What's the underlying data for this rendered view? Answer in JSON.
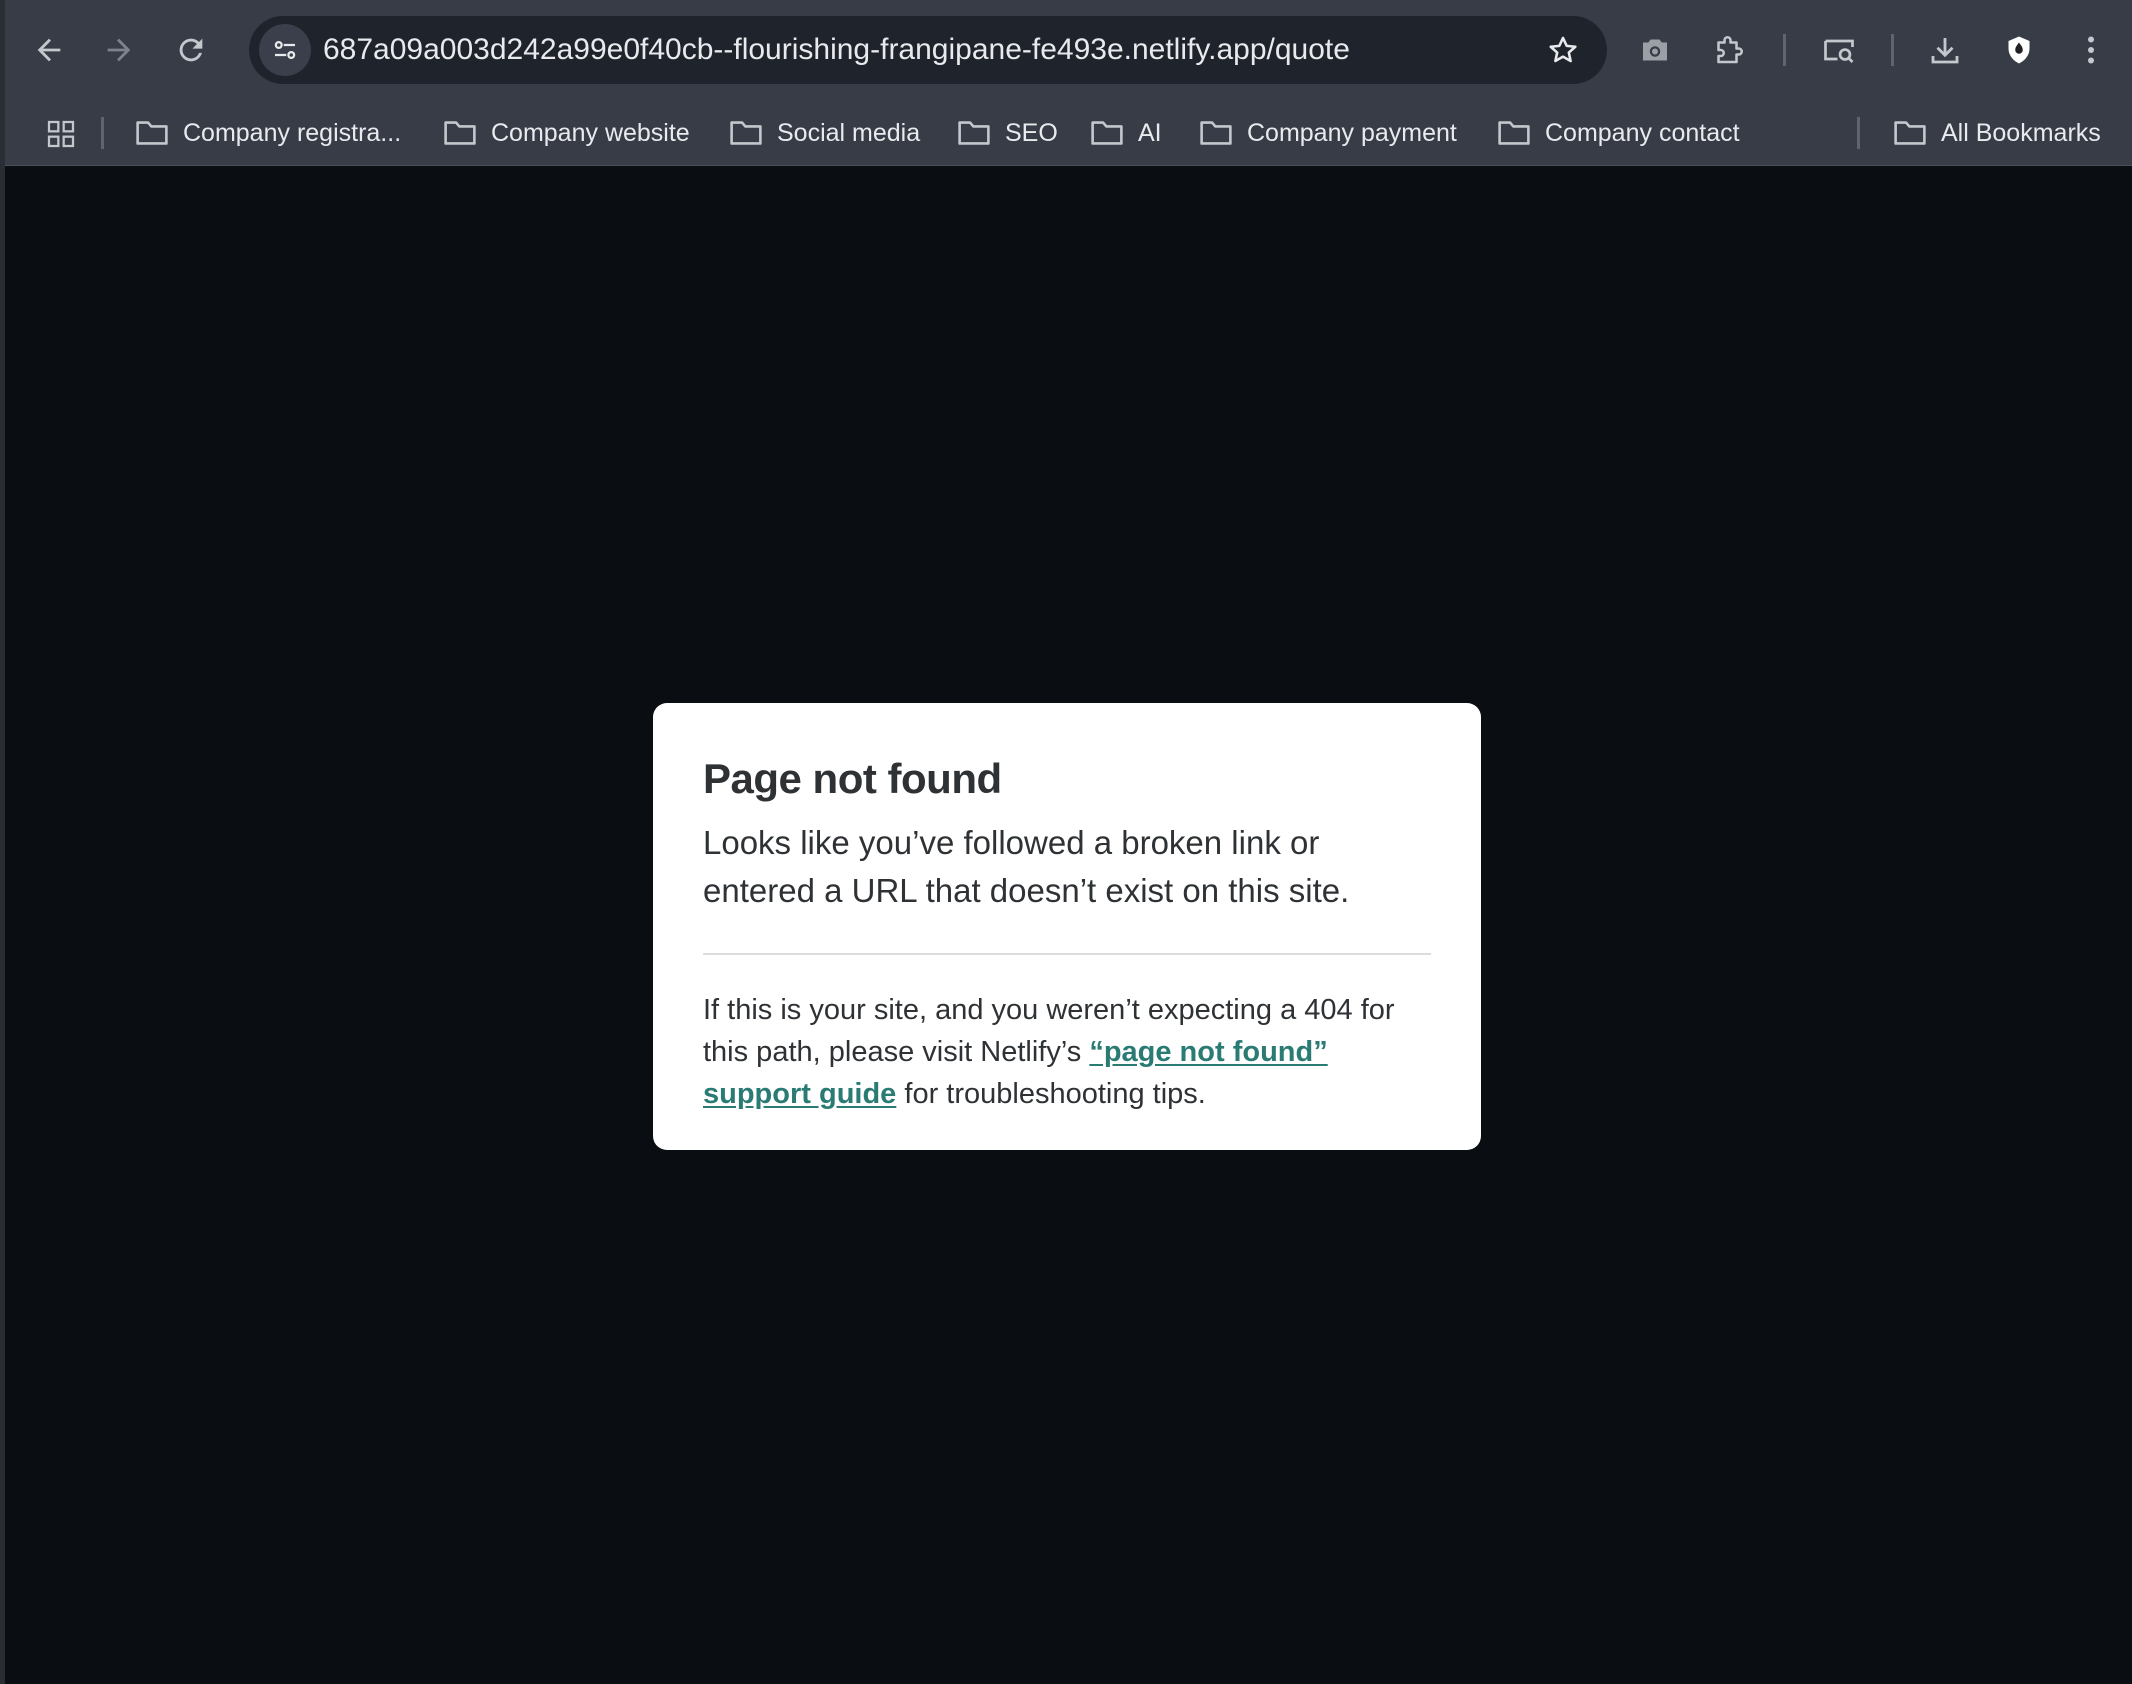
{
  "browser": {
    "url": "687a09a003d242a99e0f40cb--flourishing-frangipane-fe493e.netlify.app/quote",
    "toolbar_icons": [
      "back-arrow-icon",
      "forward-arrow-icon",
      "reload-icon",
      "site-info-icon",
      "star-icon",
      "camera-icon",
      "extension-icon",
      "media-router-icon",
      "download-icon",
      "shield-icon",
      "more-vert-icon"
    ],
    "bookmarks": [
      {
        "label": "Company registra..."
      },
      {
        "label": "Company website"
      },
      {
        "label": "Social media"
      },
      {
        "label": "SEO"
      },
      {
        "label": "AI"
      },
      {
        "label": "Company payment"
      },
      {
        "label": "Company contact"
      }
    ],
    "all_bookmarks_label": "All Bookmarks"
  },
  "page": {
    "title": "Page not found",
    "lead": "Looks like you’ve followed a broken link or entered a URL that doesn’t exist on this site.",
    "help_before": "If this is your site, and you weren’t expecting a 404 for this path, please visit Netlify’s ",
    "help_link": "“page not found” support guide",
    "help_after": " for troubleshooting tips."
  },
  "colors": {
    "page_background": "#0a0d12",
    "toolbar_background": "#373c47",
    "card_background": "#ffffff",
    "link": "#2b7b75"
  }
}
